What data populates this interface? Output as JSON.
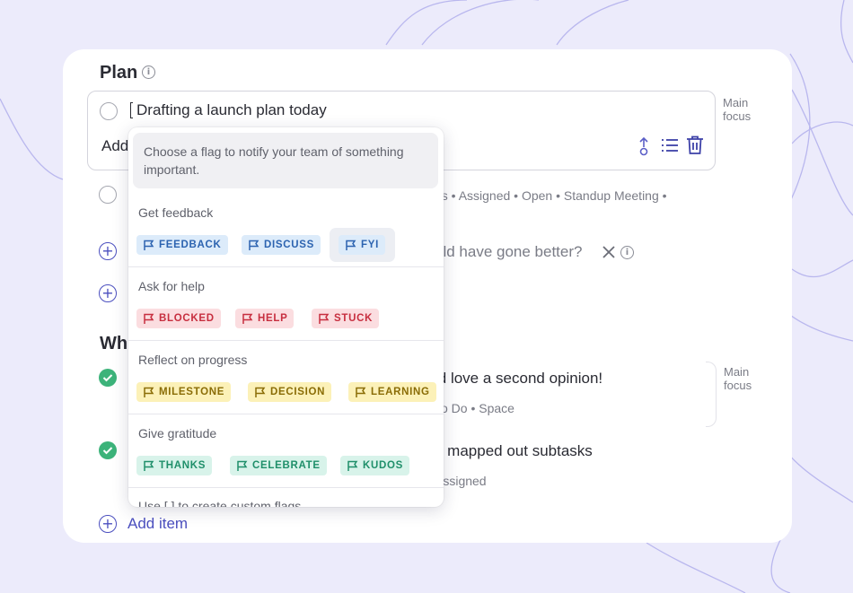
{
  "plan": {
    "heading": "Plan",
    "info_icon": "i",
    "task_title": "Drafting a launch plan today",
    "add_placeholder": "Add",
    "main_focus": "Main focus",
    "meta_row": "ns • Assigned • Open • Standup Meeting •",
    "question_partial": "uld have gone better?"
  },
  "section2": {
    "heading_partial": "Wh",
    "item1_text": "ld love a second opinion!",
    "item1_meta": "To Do • Space",
    "item1_main_focus": "Main focus",
    "item2_text": "d mapped out subtasks",
    "item2_meta": "Assigned",
    "add_item": "Add item"
  },
  "dropdown": {
    "hint": "Choose a flag to notify your team of something important.",
    "sections": [
      {
        "title": "Get feedback",
        "flags": [
          "FEEDBACK",
          "DISCUSS",
          "FYI"
        ]
      },
      {
        "title": "Ask for help",
        "flags": [
          "BLOCKED",
          "HELP",
          "STUCK"
        ]
      },
      {
        "title": "Reflect on progress",
        "flags": [
          "MILESTONE",
          "DECISION",
          "LEARNING"
        ]
      },
      {
        "title": "Give gratitude",
        "flags": [
          "THANKS",
          "CELEBRATE",
          "KUDOS"
        ]
      }
    ],
    "footer": "Use [ ] to create custom flags"
  },
  "colors": {
    "accent": "#4b4fbf",
    "blue_chip": "#dcebfa",
    "red_chip": "#fbdde0",
    "yellow_chip": "#fcf1b8",
    "green_chip": "#d8f3ea",
    "check_green": "#3cb37a"
  },
  "icons": [
    "info-icon",
    "move-icon",
    "list-icon",
    "trash-icon",
    "close-icon",
    "plus-circle-icon",
    "check-circle-icon",
    "flag-icon"
  ]
}
